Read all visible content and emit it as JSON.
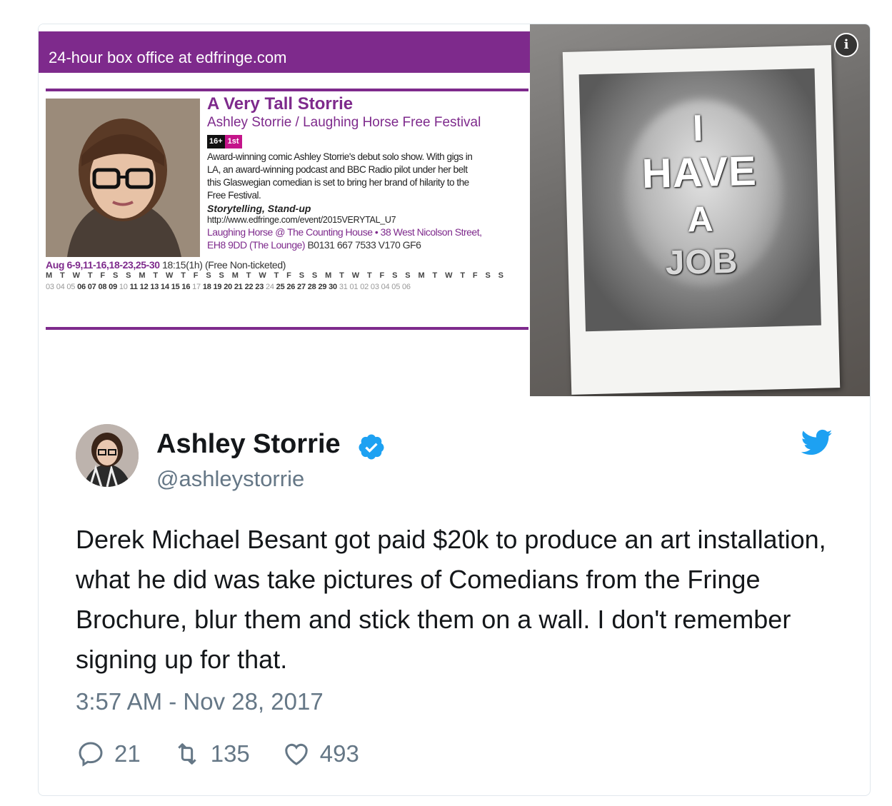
{
  "media": {
    "brochure": {
      "box_office": "24-hour box office at edfringe.com",
      "title": "A Very Tall Storrie",
      "subtitle": "Ashley Storrie / Laughing Horse Free Festival",
      "badge_age": "16+",
      "badge_first": "1st",
      "description_lines": [
        "Award-winning comic Ashley Storrie's debut solo show. With gigs in",
        "LA, an award-winning podcast and BBC Radio pilot under her belt",
        "this Glaswegian comedian is set to bring her brand of hilarity to the",
        "Free Festival."
      ],
      "genre": "Storytelling, Stand-up",
      "url": "http://www.edfringe.com/event/2015VERYTAL_U7",
      "venue_line1": "Laughing Horse @ The Counting House • 38 West Nicolson Street,",
      "venue_line2_a": "EH8 9DD (The Lounge)",
      "venue_line2_b": "B0131 667 7533 V170 GF6",
      "dates_label": "Aug 6-9,11-16,18-23,25-30",
      "time_info": "18:15(1h) (Free Non-ticketed)",
      "calendar_days": "M T W T F S S M T W T F S S M T W T F S S M T W T F S S M T W T F S S",
      "calendar_off_start": "03 04 05",
      "calendar_on": "06 07 08 09",
      "calendar_off_10": "10",
      "calendar_on2": "11 12 13 14 15 16",
      "calendar_off_17": "17",
      "calendar_on3": "18 19 20 21 22 23",
      "calendar_off_24": "24",
      "calendar_on4": "25 26 27 28 29 30",
      "calendar_off_end": "31 01 02 03 04 05 06"
    },
    "poster_lines": [
      "I",
      "HAVE",
      "A",
      "JOB"
    ]
  },
  "tweet": {
    "name": "Ashley Storrie",
    "handle": "@ashleystorrie",
    "text": "Derek Michael Besant got paid $20k to produce an art installation, what he did was take pictures of Comedians from the Fringe Brochure, blur them and stick them on a wall. I don't remember signing up for that.",
    "timestamp": "3:57 AM - Nov 28, 2017",
    "replies": "21",
    "retweets": "135",
    "likes": "493"
  },
  "colors": {
    "fringe_purple": "#7e2a8c",
    "twitter_blue": "#1da1f2",
    "secondary_text": "#657786",
    "primary_text": "#14171a"
  },
  "icons": [
    "info-icon",
    "verified-icon",
    "twitter-bird-icon",
    "reply-icon",
    "retweet-icon",
    "like-icon"
  ]
}
